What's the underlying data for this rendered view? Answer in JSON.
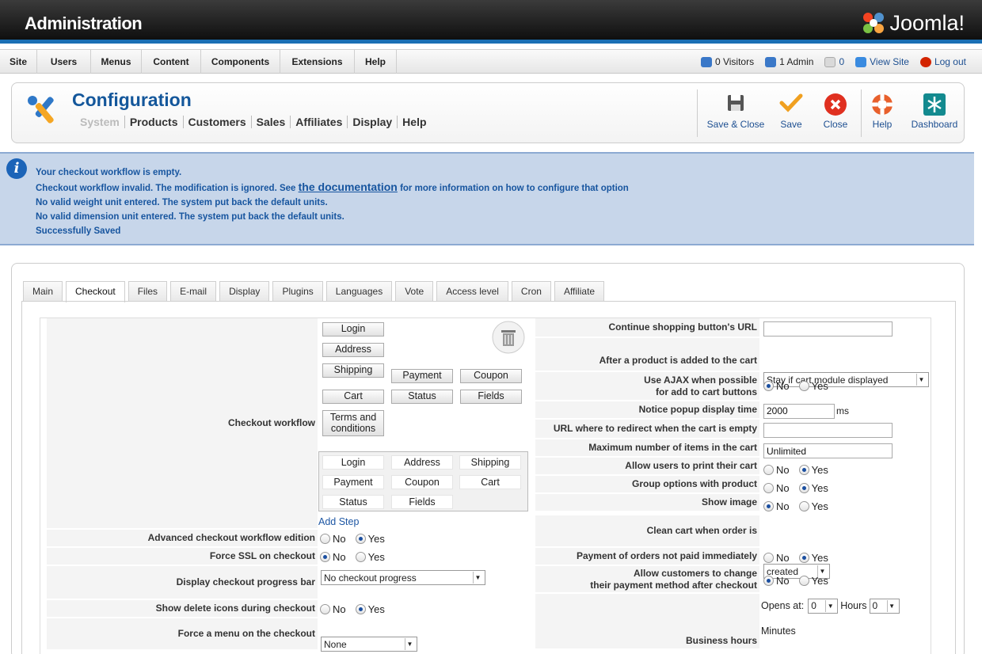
{
  "header": {
    "title": "Administration",
    "logo_text": "Joomla!"
  },
  "menu": [
    {
      "label": "Site"
    },
    {
      "label": "Users"
    },
    {
      "label": "Menus"
    },
    {
      "label": "Content"
    },
    {
      "label": "Components"
    },
    {
      "label": "Extensions"
    },
    {
      "label": "Help"
    }
  ],
  "status": {
    "visitors": "0 Visitors",
    "admins": "1 Admin",
    "messages": "0",
    "view_site": "View Site",
    "logout": "Log out"
  },
  "toolbar": {
    "title": "Configuration",
    "submenu": [
      "System",
      "Products",
      "Customers",
      "Sales",
      "Affiliates",
      "Display",
      "Help"
    ],
    "buttons": {
      "save_close": "Save & Close",
      "save": "Save",
      "close": "Close",
      "help": "Help",
      "dashboard": "Dashboard"
    }
  },
  "messages": {
    "m1": "Your checkout workflow is empty.",
    "m2_pre": "Checkout workflow invalid. The modification is ignored. See ",
    "m2_link": "the documentation",
    "m2_post": " for more information on how to configure that option",
    "m3": "No valid weight unit entered. The system put back the default units.",
    "m4": "No valid dimension unit entered. The system put back the default units.",
    "m5": "Successfully Saved"
  },
  "tabs": [
    "Main",
    "Checkout",
    "Files",
    "E-mail",
    "Display",
    "Plugins",
    "Languages",
    "Vote",
    "Access level",
    "Cron",
    "Affiliate"
  ],
  "active_tab": "Checkout",
  "left": {
    "checkout_workflow_label": "Checkout workflow",
    "workflow_steps": [
      "Login",
      "Address",
      "Shipping",
      "Cart",
      "Terms and conditions",
      "Payment",
      "Coupon",
      "Status",
      "Fields"
    ],
    "available_steps": [
      "Login",
      "Address",
      "Shipping",
      "Payment",
      "Coupon",
      "Cart",
      "Status",
      "Fields"
    ],
    "add_step": "Add Step",
    "advanced_label": "Advanced checkout workflow edition",
    "ssl_label": "Force SSL on checkout",
    "progress_label": "Display checkout progress bar",
    "progress_value": "No checkout progress",
    "delete_icons_label": "Show delete icons during checkout",
    "force_menu_label": "Force a menu on the checkout",
    "force_menu_value": "None",
    "no": "No",
    "yes": "Yes"
  },
  "right": {
    "continue_label": "Continue shopping button's URL",
    "after_added_label": "After a product is added to the cart",
    "after_added_value": "Stay if cart module displayed",
    "ajax_label_1": "Use AJAX when possible",
    "ajax_label_2": "for add to cart buttons",
    "popup_label": "Notice popup display time",
    "popup_value": "2000",
    "popup_unit": "ms",
    "redirect_label": "URL where to redirect when the cart is empty",
    "max_items_label": "Maximum number of items in the cart",
    "max_items_value": "Unlimited",
    "print_label": "Allow users to print their cart",
    "group_label": "Group options with product",
    "show_image_label": "Show image",
    "clean_label": "Clean cart when order is",
    "clean_value": "created",
    "not_paid_label": "Payment of orders not paid immediately",
    "change_label_1": "Allow customers to change",
    "change_label_2": "their payment method after checkout",
    "business_label": "Business hours",
    "opens_at": "Opens at:",
    "hours": "Hours",
    "minutes": "Minutes",
    "hour_value": "0",
    "minute_value": "0"
  }
}
